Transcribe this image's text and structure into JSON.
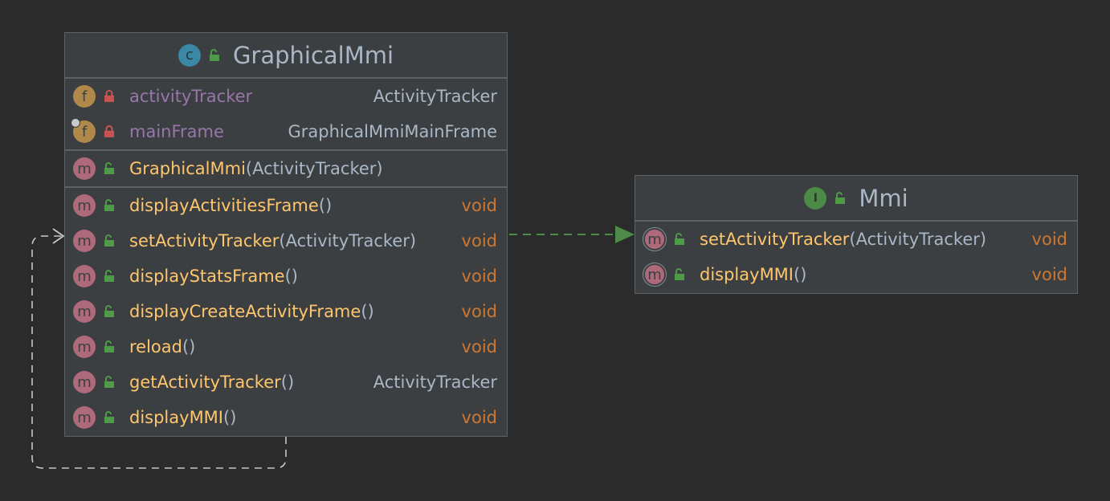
{
  "classes": {
    "graphicalMmi": {
      "name": "GraphicalMmi",
      "kind_icon": "class-icon",
      "kind_letter": "c",
      "fields": [
        {
          "icon_letter": "f",
          "name": "activityTracker",
          "type": "ActivityTracker"
        },
        {
          "icon_letter": "f",
          "name": "mainFrame",
          "type": "GraphicalMmiMainFrame"
        }
      ],
      "constructors": [
        {
          "icon_letter": "m",
          "name": "GraphicalMmi",
          "params": "(ActivityTracker)"
        }
      ],
      "methods": [
        {
          "icon_letter": "m",
          "name": "displayActivitiesFrame",
          "params": "()",
          "type": "void"
        },
        {
          "icon_letter": "m",
          "name": "setActivityTracker",
          "params": "(ActivityTracker)",
          "type": "void"
        },
        {
          "icon_letter": "m",
          "name": "displayStatsFrame",
          "params": "()",
          "type": "void"
        },
        {
          "icon_letter": "m",
          "name": "displayCreateActivityFrame",
          "params": "()",
          "type": "void"
        },
        {
          "icon_letter": "m",
          "name": "reload",
          "params": "()",
          "type": "void"
        },
        {
          "icon_letter": "m",
          "name": "getActivityTracker",
          "params": "()",
          "type": "ActivityTracker"
        },
        {
          "icon_letter": "m",
          "name": "displayMMI",
          "params": "()",
          "type": "void"
        }
      ]
    },
    "mmi": {
      "name": "Mmi",
      "kind_icon": "interface-icon",
      "kind_letter": "I",
      "methods": [
        {
          "icon_letter": "m",
          "name": "setActivityTracker",
          "params": "(ActivityTracker)",
          "type": "void"
        },
        {
          "icon_letter": "m",
          "name": "displayMMI",
          "params": "()",
          "type": "void"
        }
      ]
    }
  },
  "relations": [
    {
      "from": "GraphicalMmi",
      "to": "Mmi",
      "kind": "realization"
    },
    {
      "from": "GraphicalMmi",
      "to": "GraphicalMmi",
      "kind": "dependency"
    }
  ],
  "colors": {
    "background": "#2b2b2b",
    "node": "#3c3f41",
    "field_name": "#9876aa",
    "method_name": "#ffc66d",
    "void_type": "#cc7832",
    "realization_edge": "#4e8a4a",
    "dependency_edge": "#c8c8c8"
  }
}
